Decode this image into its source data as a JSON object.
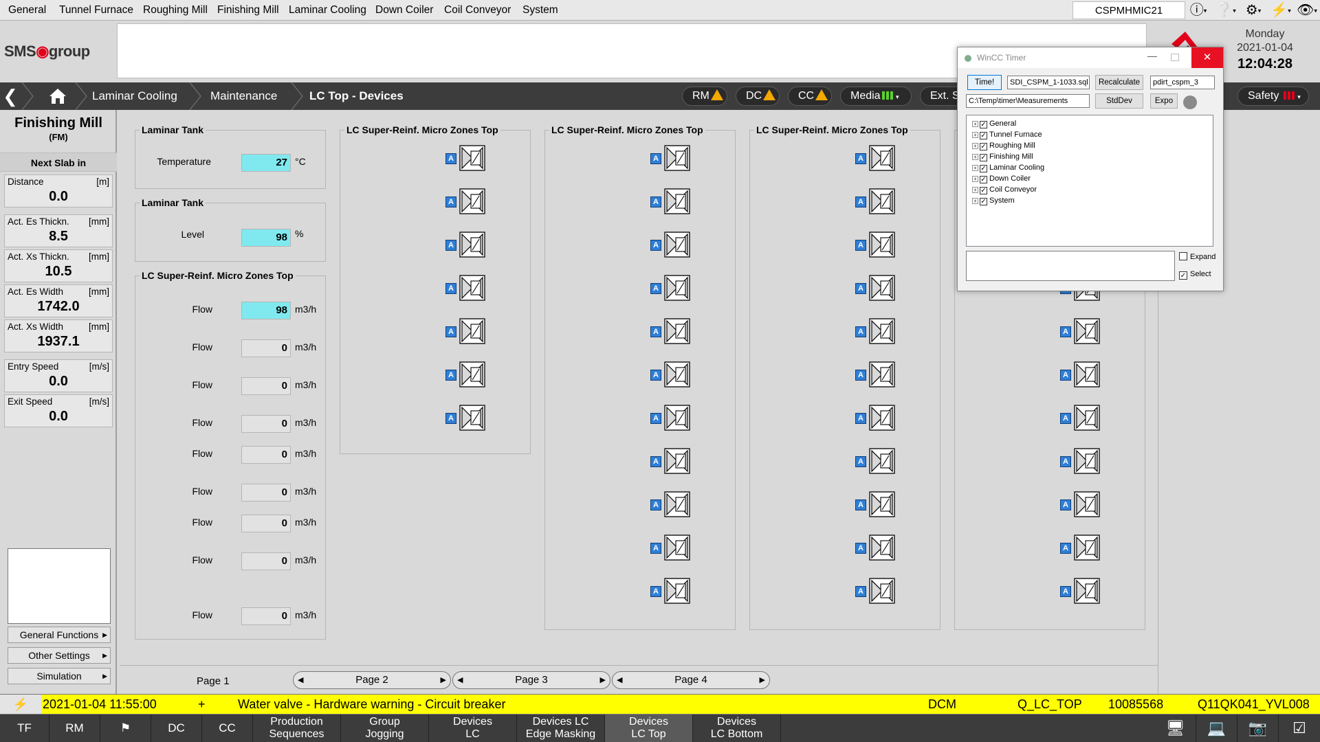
{
  "menu": [
    "General",
    "Tunnel Furnace",
    "Roughing Mill",
    "Finishing Mill",
    "Laminar Cooling",
    "Down Coiler",
    "Coil Conveyor",
    "System"
  ],
  "station": "CSPMHMIC21",
  "logo": {
    "text_a": "SMS",
    "text_b": "group"
  },
  "header": {
    "day": "Monday",
    "date": "2021-01-04",
    "time": "12:04:28"
  },
  "breadcrumb": {
    "c1": "Laminar Cooling",
    "c2": "Maintenance",
    "c3": "LC Top - Devices"
  },
  "status_pills": {
    "rm": "RM",
    "dc": "DC",
    "cc": "CC",
    "media": "Media",
    "ext": "Ext. S",
    "safety": "Safety"
  },
  "sidebar": {
    "title": "Finishing Mill",
    "subtitle": "(FM)",
    "next_slab": "Next Slab in",
    "metrics": [
      {
        "label": "Distance",
        "unit": "[m]",
        "value": "0.0"
      },
      {
        "label": "Act. Es Thickn.",
        "unit": "[mm]",
        "value": "8.5"
      },
      {
        "label": "Act. Xs Thickn.",
        "unit": "[mm]",
        "value": "10.5"
      },
      {
        "label": "Act. Es Width",
        "unit": "[mm]",
        "value": "1742.0"
      },
      {
        "label": "Act. Xs Width",
        "unit": "[mm]",
        "value": "1937.1"
      },
      {
        "label": "Entry Speed",
        "unit": "[m/s]",
        "value": "0.0"
      },
      {
        "label": "Exit Speed",
        "unit": "[m/s]",
        "value": "0.0"
      }
    ],
    "buttons": [
      "General Functions",
      "Other Settings",
      "Simulation"
    ]
  },
  "tank1": {
    "title": "Laminar Tank",
    "label": "Temperature",
    "value": "27",
    "unit": "°C"
  },
  "tank2": {
    "title": "Laminar Tank",
    "label": "Level",
    "value": "98",
    "unit": "%"
  },
  "flows": {
    "title": "LC Super-Reinf. Micro Zones Top",
    "rows": [
      {
        "label": "Flow",
        "value": "98",
        "unit": "m3/h"
      },
      {
        "label": "Flow",
        "value": "0",
        "unit": "m3/h"
      },
      {
        "label": "Flow",
        "value": "0",
        "unit": "m3/h"
      },
      {
        "label": "Flow",
        "value": "0",
        "unit": "m3/h"
      },
      {
        "label": "Flow",
        "value": "0",
        "unit": "m3/h"
      },
      {
        "label": "Flow",
        "value": "0",
        "unit": "m3/h"
      },
      {
        "label": "Flow",
        "value": "0",
        "unit": "m3/h"
      },
      {
        "label": "Flow",
        "value": "0",
        "unit": "m3/h"
      },
      {
        "label": "Flow",
        "value": "0",
        "unit": "m3/h"
      }
    ]
  },
  "device_panels": [
    {
      "title": "LC Super-Reinf. Micro Zones Top",
      "auto_label": "A"
    },
    {
      "title": "LC Super-Reinf. Micro Zones Top",
      "auto_label": "A"
    },
    {
      "title": "LC Super-Reinf. Micro Zones Top",
      "auto_label": "A"
    },
    {
      "title": "",
      "auto_label": "A"
    }
  ],
  "pages": {
    "current": "Page 1",
    "p2": "Page 2",
    "p3": "Page 3",
    "p4": "Page 4"
  },
  "alarm": {
    "timestamp": "2021-01-04  11:55:00",
    "sign": "+",
    "text": "Water valve - Hardware warning - Circuit breaker",
    "area": "DCM",
    "group": "Q_LC_TOP",
    "number": "10085568",
    "tag": "Q11QK041_YVL008"
  },
  "bottom_nav": {
    "tf": "TF",
    "rm": "RM",
    "dc": "DC",
    "cc": "CC",
    "b1a": "Production",
    "b1b": "Sequences",
    "b2a": "Group",
    "b2b": "Jogging",
    "b3a": "Devices",
    "b3b": "LC",
    "b4a": "Devices LC",
    "b4b": "Edge Masking",
    "b5a": "Devices",
    "b5b": "LC Top",
    "b6a": "Devices",
    "b6b": "LC Bottom"
  },
  "timer_dialog": {
    "title": "WinCC Timer",
    "btn_time": "Time!",
    "file": "SDI_CSPM_1-1033.sql",
    "btn_recalc": "Recalculate",
    "db": "pdirt_cspm_3",
    "path": "C:\\Temp\\timer\\Measurements",
    "btn_stddev": "StdDev",
    "btn_expo": "Expo",
    "tree": [
      "General",
      "Tunnel Furnace",
      "Roughing Mill",
      "Finishing Mill",
      "Laminar Cooling",
      "Down Coiler",
      "Coil Conveyor",
      "System"
    ],
    "expand_label": "Expand",
    "select_label": "Select",
    "expand_checked": false,
    "select_checked": true
  },
  "colors": {
    "highlight_value": "#7fe9ef",
    "alarm_yellow": "#ffff00",
    "warning": "#f5a800",
    "active_green": "#5bd22d",
    "safety_red": "#e2001a",
    "auto_blue": "#2f7fd6"
  },
  "icons": [
    "home-icon",
    "back-arrow-icon",
    "info-icon",
    "help-icon",
    "gear-icon",
    "lightning-icon",
    "eye-icon",
    "flag-icon",
    "monitor-icon",
    "screen-settings-icon",
    "camera-icon",
    "checklist-icon",
    "valve-icon",
    "auto-mode-icon"
  ]
}
